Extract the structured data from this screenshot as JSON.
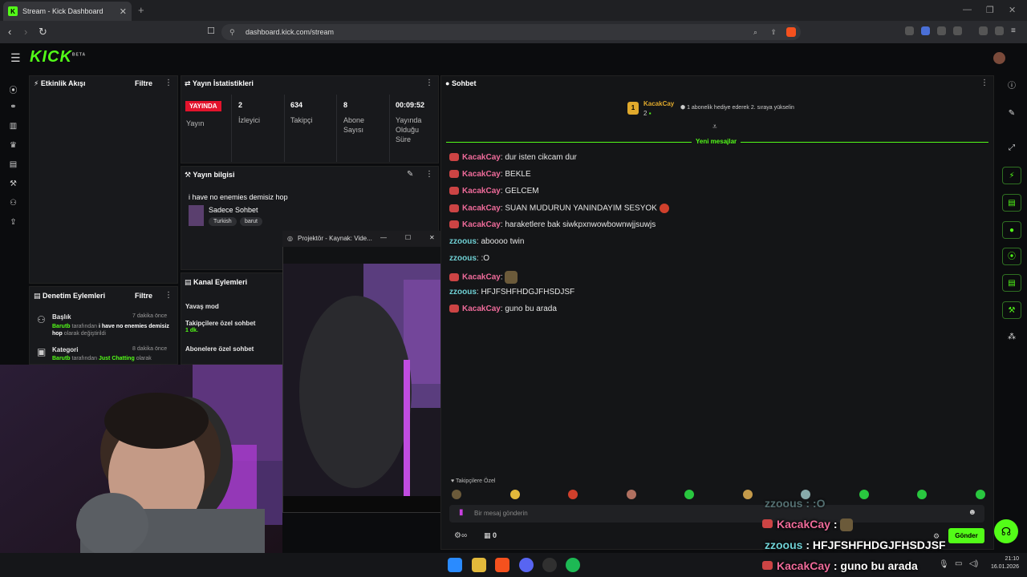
{
  "browser": {
    "tab_title": "Stream - Kick Dashboard",
    "tab_icon": "kick-logo-icon",
    "url": "dashboard.kick.com/stream"
  },
  "header": {
    "logo": "KICK",
    "logo_badge": "BETA"
  },
  "activity": {
    "title": "Etkinlik Akışı",
    "filter": "Filtre"
  },
  "stats": {
    "title": "Yayın İstatistikleri",
    "live_badge": "YAYINDA",
    "status_label": "Yayın",
    "items": [
      {
        "value": "2",
        "label": "İzleyici"
      },
      {
        "value": "634",
        "label": "Takipçi"
      },
      {
        "value": "8",
        "label": "Abone Sayısı"
      },
      {
        "value": "00:09:52",
        "label": "Yayında Olduğu Süre"
      }
    ]
  },
  "stream_info": {
    "title": "Yayın bilgisi",
    "stream_title": "i have no enemies demisiz hop",
    "category": "Sadece Sohbet",
    "tags": [
      "Turkish",
      "barut"
    ]
  },
  "moderation": {
    "title": "Denetim Eylemleri",
    "filter": "Filtre",
    "items": [
      {
        "heading": "Başlık",
        "time": "7 dakika önce",
        "user": "Barutb",
        "mid": "tarafından",
        "value": "i have no enemies demisiz hop",
        "suffix": "olarak değiştirildi"
      },
      {
        "heading": "Kategori",
        "time": "8 dakika önce",
        "user": "Barutb",
        "mid": "tarafından",
        "value": "Just Chatting",
        "suffix": "olarak"
      }
    ]
  },
  "channel_actions": {
    "title": "Kanal Eylemleri",
    "items": [
      {
        "label": "Yavaş mod",
        "sub": ""
      },
      {
        "label": "Takipçilere özel sohbet",
        "sub": "1 dk."
      },
      {
        "label": "Abonelere özel sohbet",
        "sub": ""
      }
    ]
  },
  "projector": {
    "title": "Projektör - Kaynak: Vide..."
  },
  "chat": {
    "title": "Sohbet",
    "pinned_user": "KacakCay",
    "pinned_count": "2",
    "pinned_rank": "1",
    "pinned_text": "1 abonelik hediye ederek 2. sıraya yükselin",
    "new_messages": "Yeni mesajlar",
    "messages": [
      {
        "user": "KacakCay",
        "text": "dur isten cikcam dur",
        "style": "u1"
      },
      {
        "user": "KacakCay",
        "text": "BEKLE",
        "style": "u1"
      },
      {
        "user": "KacakCay",
        "text": "GELCEM",
        "style": "u1"
      },
      {
        "user": "KacakCay",
        "text": "SUAN MUDURUN YANINDAYIM SESYOK",
        "style": "u1"
      },
      {
        "user": "KacakCay",
        "text": "haraketlere bak siwkpxnwowbownwjjsuwjs",
        "style": "u1"
      },
      {
        "user": "zzoous",
        "text": "aboooo twin",
        "style": "u2"
      },
      {
        "user": "zzoous",
        "text": ":O",
        "style": "u2"
      },
      {
        "user": "KacakCay",
        "text": "",
        "style": "u1"
      },
      {
        "user": "zzoous",
        "text": "HFJFSHFHDGJFHSDJSF",
        "style": "u2"
      },
      {
        "user": "KacakCay",
        "text": "guno bu arada",
        "style": "u1"
      }
    ],
    "followers_only": "Takipçilere Özel",
    "input_placeholder": "Bir mesaj gönderin",
    "points": "0",
    "send": "Gönder"
  },
  "overlay_chat": [
    {
      "user": "zzoous",
      "sep": " : ",
      "text": ":O"
    },
    {
      "user": "KacakCay",
      "sep": " : ",
      "text": ""
    },
    {
      "user": "zzoous",
      "sep": " : ",
      "text": "HFJFSHFHDGJFHSDJSF"
    },
    {
      "user": "KacakCay",
      "sep": " : ",
      "text": "guno bu arada"
    }
  ],
  "taskbar": {
    "time": "21:10",
    "date": "16.01.2026"
  },
  "colors": {
    "brand": "#53fc18",
    "live": "#e3132c",
    "user_pink": "#ef6b9a",
    "user_cyan": "#6fd0d4"
  }
}
